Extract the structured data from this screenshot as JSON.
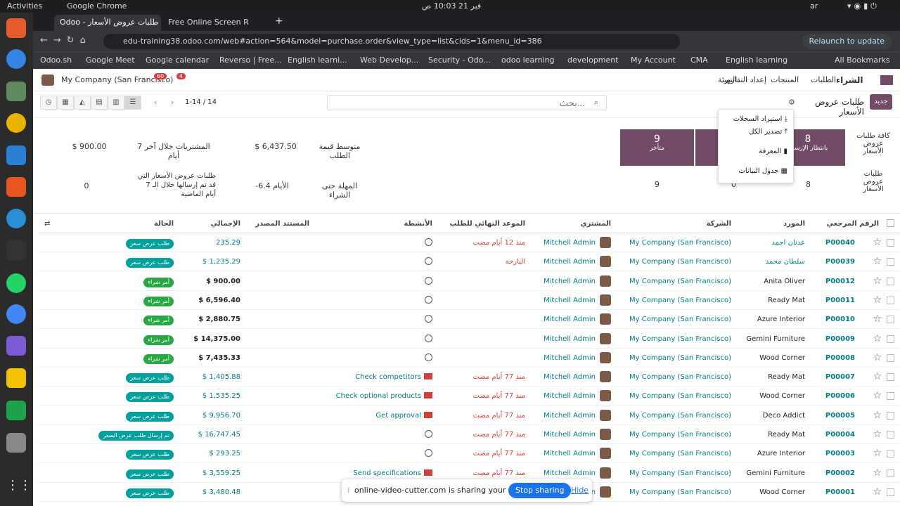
{
  "system": {
    "activities": "Activities",
    "app_name": "Google Chrome",
    "datetime": "فبر 21  10:03 ص",
    "lang": "ar"
  },
  "browser": {
    "tabs": [
      {
        "label": "Odoo - طلبات عروض الأسعار"
      },
      {
        "label": "Free Online Screen R"
      }
    ],
    "url": "edu-training38.odoo.com/web#action=564&model=purchase.order&view_type=list&cids=1&menu_id=386",
    "relaunch": "Relaunch to update",
    "bookmarks": [
      "Odoo.sh",
      "Google Meet",
      "Google calendar",
      "Reverso | Free...",
      "English learni...",
      "Web Develop...",
      "Security - Odo...",
      "odoo learning",
      "development",
      "My Account",
      "CMA",
      "English learning",
      "All Bookmarks"
    ]
  },
  "nav": {
    "company": "My Company (San Francisco)",
    "badge1": "60",
    "badge2": "4",
    "items": [
      "الشراء",
      "الطلبات",
      "المنتجات",
      "إعداد التقارير",
      "التهيئة"
    ]
  },
  "controls": {
    "new": "جديد",
    "title": "طلبات عروض الأسعار",
    "search_placeholder": "بحث...",
    "pager": "1-14 / 14"
  },
  "menu": {
    "items": [
      "استيراد السجلات",
      "تصدير الكل",
      "المعرفة",
      "جدول البيانات"
    ]
  },
  "dashboard": {
    "row1_label": "كافة طلبات عروض الأسعار",
    "row2_label": "طلبات عروض الأسعار",
    "tile1_value": "8",
    "tile1_label": "بانتظار الإرسال",
    "tile3_value": "9",
    "tile3_label": "متأخر",
    "row2_v1": "8",
    "row2_v2": "0",
    "row2_v3": "9",
    "avg_label": "متوسط قيمة الطلب",
    "avg_value": "$ 6,437.50",
    "week_label": "المشتريات خلال آخر 7 أيام",
    "week_value": "$ 900.00",
    "lead_label": "المهلة حتى الشراء",
    "lead_value": "-6.4 الأيام",
    "sent_label": "طلبات عروض الأسعار التي قد تم إرسالها خلال الـ 7 أيام الماضية",
    "sent_value": "0"
  },
  "table": {
    "headers": {
      "ref": "الرقم المرجعي",
      "vendor": "المورد",
      "company": "الشركة",
      "buyer": "المشتري",
      "deadline": "الموعد النهائي للطلب",
      "activities": "الأنشطة",
      "source": "المستند المصدر",
      "total": "الإجمالي",
      "status": "الحالة"
    },
    "rows": [
      {
        "ref": "P00040",
        "vendor": "عدنان احمد",
        "company": "My Company (San Francisco)",
        "buyer": "Mitchell Admin",
        "deadline": "منذ 12 أيام مضت",
        "activity": "",
        "total": "235.29",
        "status": "طلب عرض سعر",
        "kind": "rfq"
      },
      {
        "ref": "P00039",
        "vendor": "سلطان محمد",
        "company": "My Company (San Francisco)",
        "buyer": "Mitchell Admin",
        "deadline": "البارحة",
        "activity": "",
        "total": "$ 1,235.29",
        "status": "طلب عرض سعر",
        "kind": "rfq"
      },
      {
        "ref": "P00012",
        "vendor": "Anita Oliver",
        "company": "My Company (San Francisco)",
        "buyer": "Mitchell Admin",
        "deadline": "",
        "activity": "",
        "total": "$ 900.00",
        "status": "أمر شراء",
        "kind": "po"
      },
      {
        "ref": "P00011",
        "vendor": "Ready Mat",
        "company": "My Company (San Francisco)",
        "buyer": "Mitchell Admin",
        "deadline": "",
        "activity": "",
        "total": "$ 6,596.40",
        "status": "أمر شراء",
        "kind": "po"
      },
      {
        "ref": "P00010",
        "vendor": "Azure Interior",
        "company": "My Company (San Francisco)",
        "buyer": "Mitchell Admin",
        "deadline": "",
        "activity": "",
        "total": "$ 2,880.75",
        "status": "أمر شراء",
        "kind": "po"
      },
      {
        "ref": "P00009",
        "vendor": "Gemini Furniture",
        "company": "My Company (San Francisco)",
        "buyer": "Mitchell Admin",
        "deadline": "",
        "activity": "",
        "total": "$ 14,375.00",
        "status": "أمر شراء",
        "kind": "po"
      },
      {
        "ref": "P00008",
        "vendor": "Wood Corner",
        "company": "My Company (San Francisco)",
        "buyer": "Mitchell Admin",
        "deadline": "",
        "activity": "",
        "total": "$ 7,435.33",
        "status": "أمر شراء",
        "kind": "po"
      },
      {
        "ref": "P00007",
        "vendor": "Ready Mat",
        "company": "My Company (San Francisco)",
        "buyer": "Mitchell Admin",
        "deadline": "منذ 77 أيام مضت",
        "activity": "Check competitors",
        "total": "$ 1,405.88",
        "status": "طلب عرض سعر",
        "kind": "rfq"
      },
      {
        "ref": "P00006",
        "vendor": "Wood Corner",
        "company": "My Company (San Francisco)",
        "buyer": "Mitchell Admin",
        "deadline": "منذ 77 أيام مضت",
        "activity": "Check optional products",
        "total": "$ 1,535.25",
        "status": "طلب عرض سعر",
        "kind": "rfq"
      },
      {
        "ref": "P00005",
        "vendor": "Deco Addict",
        "company": "My Company (San Francisco)",
        "buyer": "Mitchell Admin",
        "deadline": "منذ 77 أيام مضت",
        "activity": "Get approval",
        "total": "$ 9,956.70",
        "status": "طلب عرض سعر",
        "kind": "rfq"
      },
      {
        "ref": "P00004",
        "vendor": "Ready Mat",
        "company": "My Company (San Francisco)",
        "buyer": "Mitchell Admin",
        "deadline": "منذ 77 أيام مضت",
        "activity": "",
        "total": "$ 16,747.45",
        "status": "تم إرسال طلب عرض السعر",
        "kind": "sent"
      },
      {
        "ref": "P00003",
        "vendor": "Azure Interior",
        "company": "My Company (San Francisco)",
        "buyer": "Mitchell Admin",
        "deadline": "منذ 77 أيام مضت",
        "activity": "",
        "total": "$ 293.25",
        "status": "طلب عرض سعر",
        "kind": "rfq"
      },
      {
        "ref": "P00002",
        "vendor": "Gemini Furniture",
        "company": "My Company (San Francisco)",
        "buyer": "Mitchell Admin",
        "deadline": "منذ 77 أيام مضت",
        "activity": "Send specifications",
        "total": "$ 3,559.25",
        "status": "طلب عرض سعر",
        "kind": "rfq"
      },
      {
        "ref": "P00001",
        "vendor": "Wood Corner",
        "company": "My Company (San Francisco)",
        "buyer": "Mitchell Admin",
        "deadline": "",
        "activity": "",
        "total": "$ 3,480.48",
        "status": "طلب عرض سعر",
        "kind": "rfq"
      }
    ]
  },
  "share": {
    "text": "online-video-cutter.com is sharing your screen.",
    "stop": "Stop sharing",
    "hide": "Hide"
  }
}
